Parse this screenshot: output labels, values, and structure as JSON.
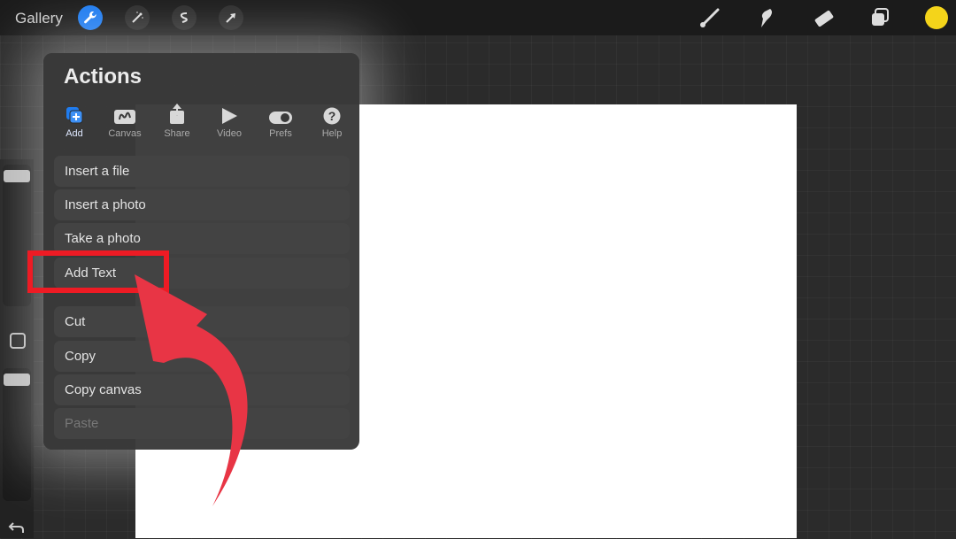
{
  "topbar": {
    "gallery_label": "Gallery",
    "left_tools": [
      "wrench-icon",
      "magic-wand-icon",
      "selection-icon",
      "transform-arrow-icon"
    ],
    "right_tools": [
      "brush-icon",
      "smudge-icon",
      "eraser-icon",
      "layers-icon"
    ],
    "current_color": "#f4d41a"
  },
  "panel": {
    "title": "Actions",
    "tabs": [
      {
        "label": "Add",
        "icon": "add-image-icon",
        "active": true
      },
      {
        "label": "Canvas",
        "icon": "canvas-icon"
      },
      {
        "label": "Share",
        "icon": "share-icon"
      },
      {
        "label": "Video",
        "icon": "play-icon"
      },
      {
        "label": "Prefs",
        "icon": "toggle-icon"
      },
      {
        "label": "Help",
        "icon": "help-icon"
      }
    ],
    "items": [
      {
        "label": "Insert a file"
      },
      {
        "label": "Insert a photo"
      },
      {
        "label": "Take a photo"
      },
      {
        "label": "Add Text"
      },
      {
        "label": "Cut"
      },
      {
        "label": "Copy"
      },
      {
        "label": "Copy canvas"
      },
      {
        "label": "Paste",
        "disabled": true
      }
    ]
  },
  "colors": {
    "accent": "#1f7cf0",
    "annotation": "#ee1b24",
    "arrow": "#e83545"
  }
}
